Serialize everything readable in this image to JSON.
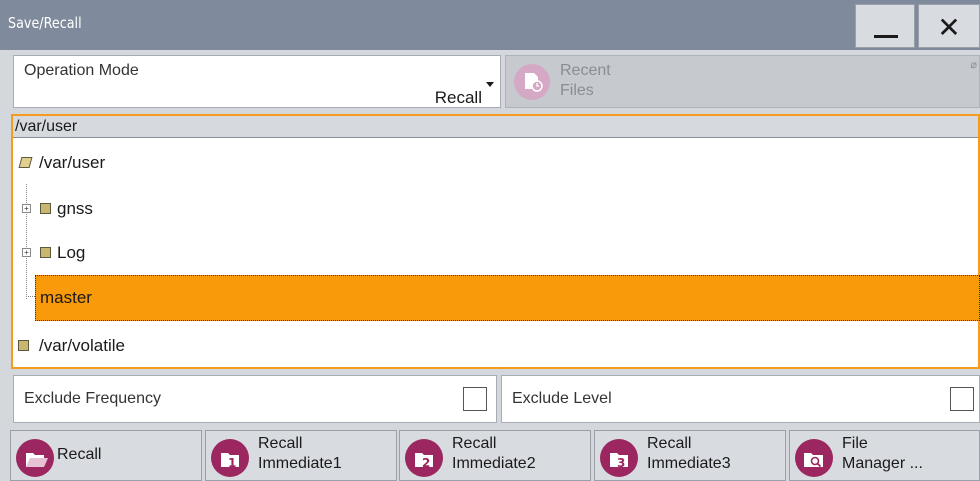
{
  "window": {
    "title": "Save/Recall"
  },
  "operation_mode": {
    "label": "Operation Mode",
    "value": "Recall"
  },
  "recent_files": {
    "line1": "Recent",
    "line2": "Files"
  },
  "path": {
    "header": "/var/user",
    "tree": {
      "root": "/var/user",
      "children": [
        "gnss",
        "Log",
        "master"
      ],
      "selected": "master",
      "other_root": "/var/volatile"
    }
  },
  "exclude": {
    "frequency_label": "Exclude Frequency",
    "level_label": "Exclude Level"
  },
  "buttons": {
    "recall": "Recall",
    "recall_immediate1": {
      "line1": "Recall",
      "line2": "Immediate1"
    },
    "recall_immediate2": {
      "line1": "Recall",
      "line2": "Immediate2"
    },
    "recall_immediate3": {
      "line1": "Recall",
      "line2": "Immediate3"
    },
    "file_manager": {
      "line1": "File",
      "line2": "Manager ..."
    }
  },
  "colors": {
    "accent": "#f39c1e",
    "selection": "#f99a0a",
    "icon": "#9c2760",
    "titlebar": "#7f8a9c"
  }
}
